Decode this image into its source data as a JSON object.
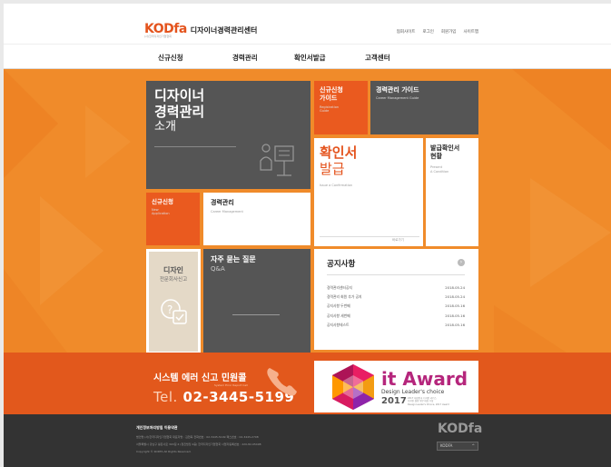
{
  "header": {
    "logo": "KODfa",
    "site_title": "디자이너경력관리센터",
    "logo_sub": "(사)한국디자인기업협회",
    "utility_links": [
      "협회사이트",
      "로그인",
      "회원가입",
      "사이트맵"
    ]
  },
  "nav": {
    "items": [
      "신규신청",
      "경력관리",
      "확인서발급",
      "고객센터"
    ]
  },
  "tiles": {
    "intro": {
      "line1": "디자이너",
      "line2": "경력관리",
      "line3": "소개"
    },
    "new_guide": {
      "line1": "신규신청",
      "line2": "가이드",
      "en1": "Registration",
      "en2": "Guide"
    },
    "career_guide": {
      "title": "경력관리 가이드",
      "en": "Career Management Guide"
    },
    "certificate": {
      "line1": "확인서",
      "line2": "발급",
      "en": "Issue a Confirmation",
      "more": "바로가기"
    },
    "status": {
      "line1": "발급확인서",
      "line2": "현황",
      "en1": "Present",
      "en2": "A Condition"
    },
    "apply": {
      "title": "신규신청",
      "en1": "New",
      "en2": "Application"
    },
    "career": {
      "title": "경력관리",
      "en": "Career Management"
    },
    "design_report": {
      "line1": "디자인",
      "line2": "전문회사신고"
    },
    "faq": {
      "title": "자주 묻는 질문",
      "en": "Q&A"
    }
  },
  "notice": {
    "title": "공지사항",
    "more": "›",
    "rows": [
      {
        "title": "경력관리센터공지",
        "date": "2018.05.24"
      },
      {
        "title": "경력관리 회원 추가 공지",
        "date": "2018.05.24"
      },
      {
        "title": "공지사항 두번째",
        "date": "2018.05.16"
      },
      {
        "title": "공지사항 세번째",
        "date": "2018.05.16"
      },
      {
        "title": "공지사항테스트",
        "date": "2018.05.16"
      }
    ]
  },
  "band": {
    "title": "시스템 에러 신고 민원콜",
    "sub": "System Error Report Call",
    "tel_label": "Tel.",
    "tel_number": "02-3445-5199"
  },
  "award": {
    "title": "it Award",
    "subtitle": "Design Leader's choice",
    "year": "2017",
    "fine1": "2017 대한민국 디자인 리더스",
    "fine2": "디자인 경영 부문 대상 수상",
    "fine3": "Design Leader's Choice, 2017 Award"
  },
  "footer": {
    "links": "개인정보처리방침   이용약관",
    "line1": "법인명 (사)한국디자인기업협회    대표자명 : 김현옥    전화번호 : 02-3445-5199    팩스번호 : 02-3445-2708",
    "line2": "서울특별시 강남구 봉은사로 303길 4 (청진빌딩 4층) 한국디자인기업협회    사업자등록번호 : 220-82-05498",
    "line3": "Copyright © KODFA All Rights Reserved.",
    "logo": "KODfa",
    "select_value": "KODFA"
  },
  "colors": {
    "orange": "#f08b2a",
    "red_orange": "#ea5a1f",
    "dark_tile": "#555555",
    "footer": "#333333"
  }
}
